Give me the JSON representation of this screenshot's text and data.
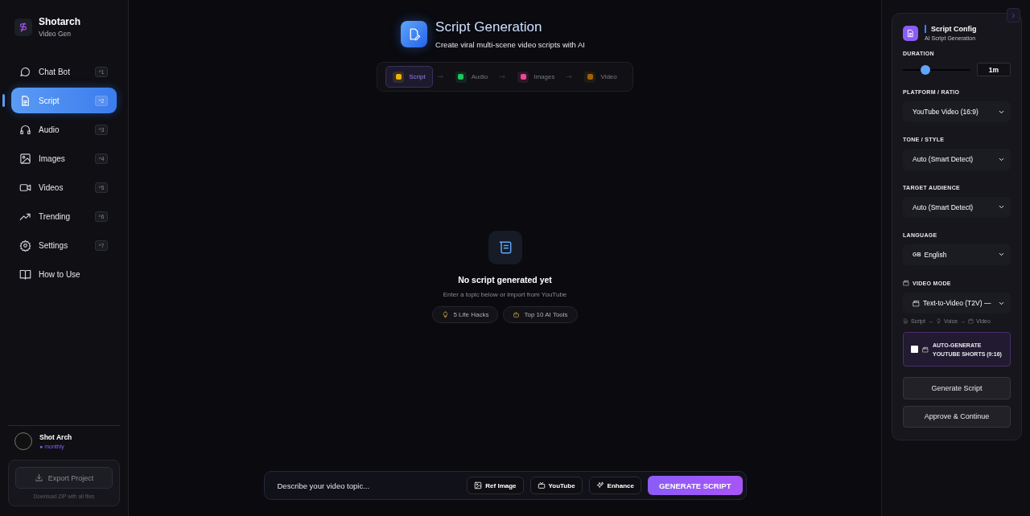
{
  "sidebar": {
    "brand": {
      "name": "Shotarch",
      "subtitle": "Video Gen"
    },
    "items": [
      {
        "label": "Chat Bot",
        "shortcut": "^1",
        "selected": false
      },
      {
        "label": "Script",
        "shortcut": "^2",
        "selected": true
      },
      {
        "label": "Audio",
        "shortcut": "^3",
        "selected": false
      },
      {
        "label": "Images",
        "shortcut": "^4",
        "selected": false
      },
      {
        "label": "Videos",
        "shortcut": "^5",
        "selected": false
      },
      {
        "label": "Trending",
        "shortcut": "^6",
        "selected": false
      },
      {
        "label": "Settings",
        "shortcut": "^7",
        "selected": false
      },
      {
        "label": "How to Use",
        "selected": false
      }
    ],
    "user": {
      "name": "Shot Arch",
      "plan": "● monthly"
    },
    "export": {
      "button": "Export Project",
      "note": "Download ZIP with all files"
    }
  },
  "header": {
    "title": "Script Generation",
    "subtitle": "Create viral multi-scene video scripts with AI"
  },
  "steps": [
    {
      "label": "Script",
      "color": "#eab308",
      "selected": true
    },
    {
      "label": "Audio",
      "color": "#22c55e",
      "selected": false
    },
    {
      "label": "Images",
      "color": "#ec4899",
      "selected": false
    },
    {
      "label": "Video",
      "color": "#a16207",
      "selected": false
    }
  ],
  "empty_state": {
    "title": "No script generated yet",
    "subtitle": "Enter a topic below or import from YouTube",
    "suggestions": [
      "5 Life Hacks",
      "Top 10 AI Tools"
    ]
  },
  "prompt_bar": {
    "placeholder": "Describe your video topic...",
    "buttons": [
      "Ref Image",
      "YouTube",
      "Enhance"
    ],
    "submit": "GENERATE SCRIPT"
  },
  "config": {
    "title": "Script Config",
    "subtitle": "AI Script Generation",
    "duration": {
      "label": "DURATION",
      "level": 0.33,
      "reading": "1m"
    },
    "selects": [
      {
        "label": "PLATFORM / RATIO",
        "value": "YouTube Video (16:9)"
      },
      {
        "label": "TONE / STYLE",
        "value": "Auto (Smart Detect)"
      },
      {
        "label": "TARGET AUDIENCE",
        "value": "Auto (Smart Detect)"
      },
      {
        "label": "LANGUAGE",
        "flag": "GB",
        "value": "English"
      },
      {
        "label": "VIDEO MODE",
        "value": "Text-to-Video (T2V) —"
      }
    ],
    "pipeline": {
      "steps": [
        "Script",
        "Voice",
        "Video"
      ],
      "separator": "→"
    },
    "shorts": {
      "label": "AUTO-GENERATE YOUTUBE SHORTS (9:16)",
      "checked": false
    },
    "actions": [
      "Generate Script",
      "Approve & Continue"
    ]
  }
}
